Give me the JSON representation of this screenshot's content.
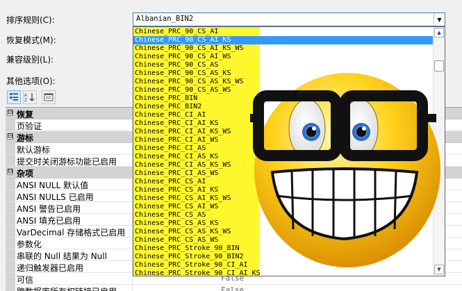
{
  "labels": {
    "sort_rule": "排序规则(C):",
    "recovery_mode": "恢复模式(M):",
    "compat_level": "兼容级别(L):",
    "other_options": "其他选项(O):"
  },
  "collation": {
    "selected_value": "Albanian_BIN2",
    "highlighted": "Chinese_PRC_90_CS_AI_KS",
    "options": [
      "Chinese_PRC_90_CS_AI",
      "Chinese_PRC_90_CS_AI_KS",
      "Chinese_PRC_90_CS_AI_KS_WS",
      "Chinese_PRC_90_CS_AI_WS",
      "Chinese_PRC_90_CS_AS",
      "Chinese_PRC_90_CS_AS_KS",
      "Chinese_PRC_90_CS_AS_KS_WS",
      "Chinese_PRC_90_CS_AS_WS",
      "Chinese_PRC_BIN",
      "Chinese_PRC_BIN2",
      "Chinese_PRC_CI_AI",
      "Chinese_PRC_CI_AI_KS",
      "Chinese_PRC_CI_AI_KS_WS",
      "Chinese_PRC_CI_AI_WS",
      "Chinese_PRC_CI_AS",
      "Chinese_PRC_CI_AS_KS",
      "Chinese_PRC_CI_AS_KS_WS",
      "Chinese_PRC_CI_AS_WS",
      "Chinese_PRC_CS_AI",
      "Chinese_PRC_CS_AI_KS",
      "Chinese_PRC_CS_AI_KS_WS",
      "Chinese_PRC_CS_AI_WS",
      "Chinese_PRC_CS_AS",
      "Chinese_PRC_CS_AS_KS",
      "Chinese_PRC_CS_AS_KS_WS",
      "Chinese_PRC_CS_AS_WS",
      "Chinese_PRC_Stroke_90_BIN",
      "Chinese_PRC_Stroke_90_BIN2",
      "Chinese_PRC_Stroke_90_CI_AI",
      "Chinese_PRC_Stroke_90_CI_AI_KS"
    ]
  },
  "toolbar": {
    "categorized_icon": "categorized-icon",
    "alpha_sort_icon": "alphabetical-sort-icon",
    "property_pages_icon": "property-pages-icon"
  },
  "grid": {
    "rows": [
      {
        "type": "category",
        "label": "恢复",
        "expander": "⊟"
      },
      {
        "type": "prop",
        "label": "页验证"
      },
      {
        "type": "category",
        "label": "游标",
        "expander": "⊟"
      },
      {
        "type": "prop",
        "label": "默认游标"
      },
      {
        "type": "prop",
        "label": "提交时关闭游标功能已启用"
      },
      {
        "type": "category",
        "label": "杂项",
        "expander": "⊟"
      },
      {
        "type": "prop",
        "label": "ANSI NULL 默认值"
      },
      {
        "type": "prop",
        "label": "ANSI NULLS 已启用"
      },
      {
        "type": "prop",
        "label": "ANSI 警告已启用"
      },
      {
        "type": "prop",
        "label": "ANSI 填充已启用"
      },
      {
        "type": "prop",
        "label": "VarDecimal 存储格式已启用"
      },
      {
        "type": "prop",
        "label": "参数化"
      },
      {
        "type": "prop",
        "label": "串联的 Null 结果为 Null"
      },
      {
        "type": "prop",
        "label": "递归触发器已启用"
      },
      {
        "type": "prop",
        "label": "可信",
        "value": "False"
      },
      {
        "type": "prop",
        "label": "跨数据库所有权链接已启用",
        "value": "False"
      }
    ]
  },
  "colors": {
    "highlight_yellow": "#fff72e",
    "selection_blue": "#3399ff",
    "smiley_yellow": "#ffd21a"
  },
  "overlay": {
    "icon": "nerd-smiley-icon"
  }
}
